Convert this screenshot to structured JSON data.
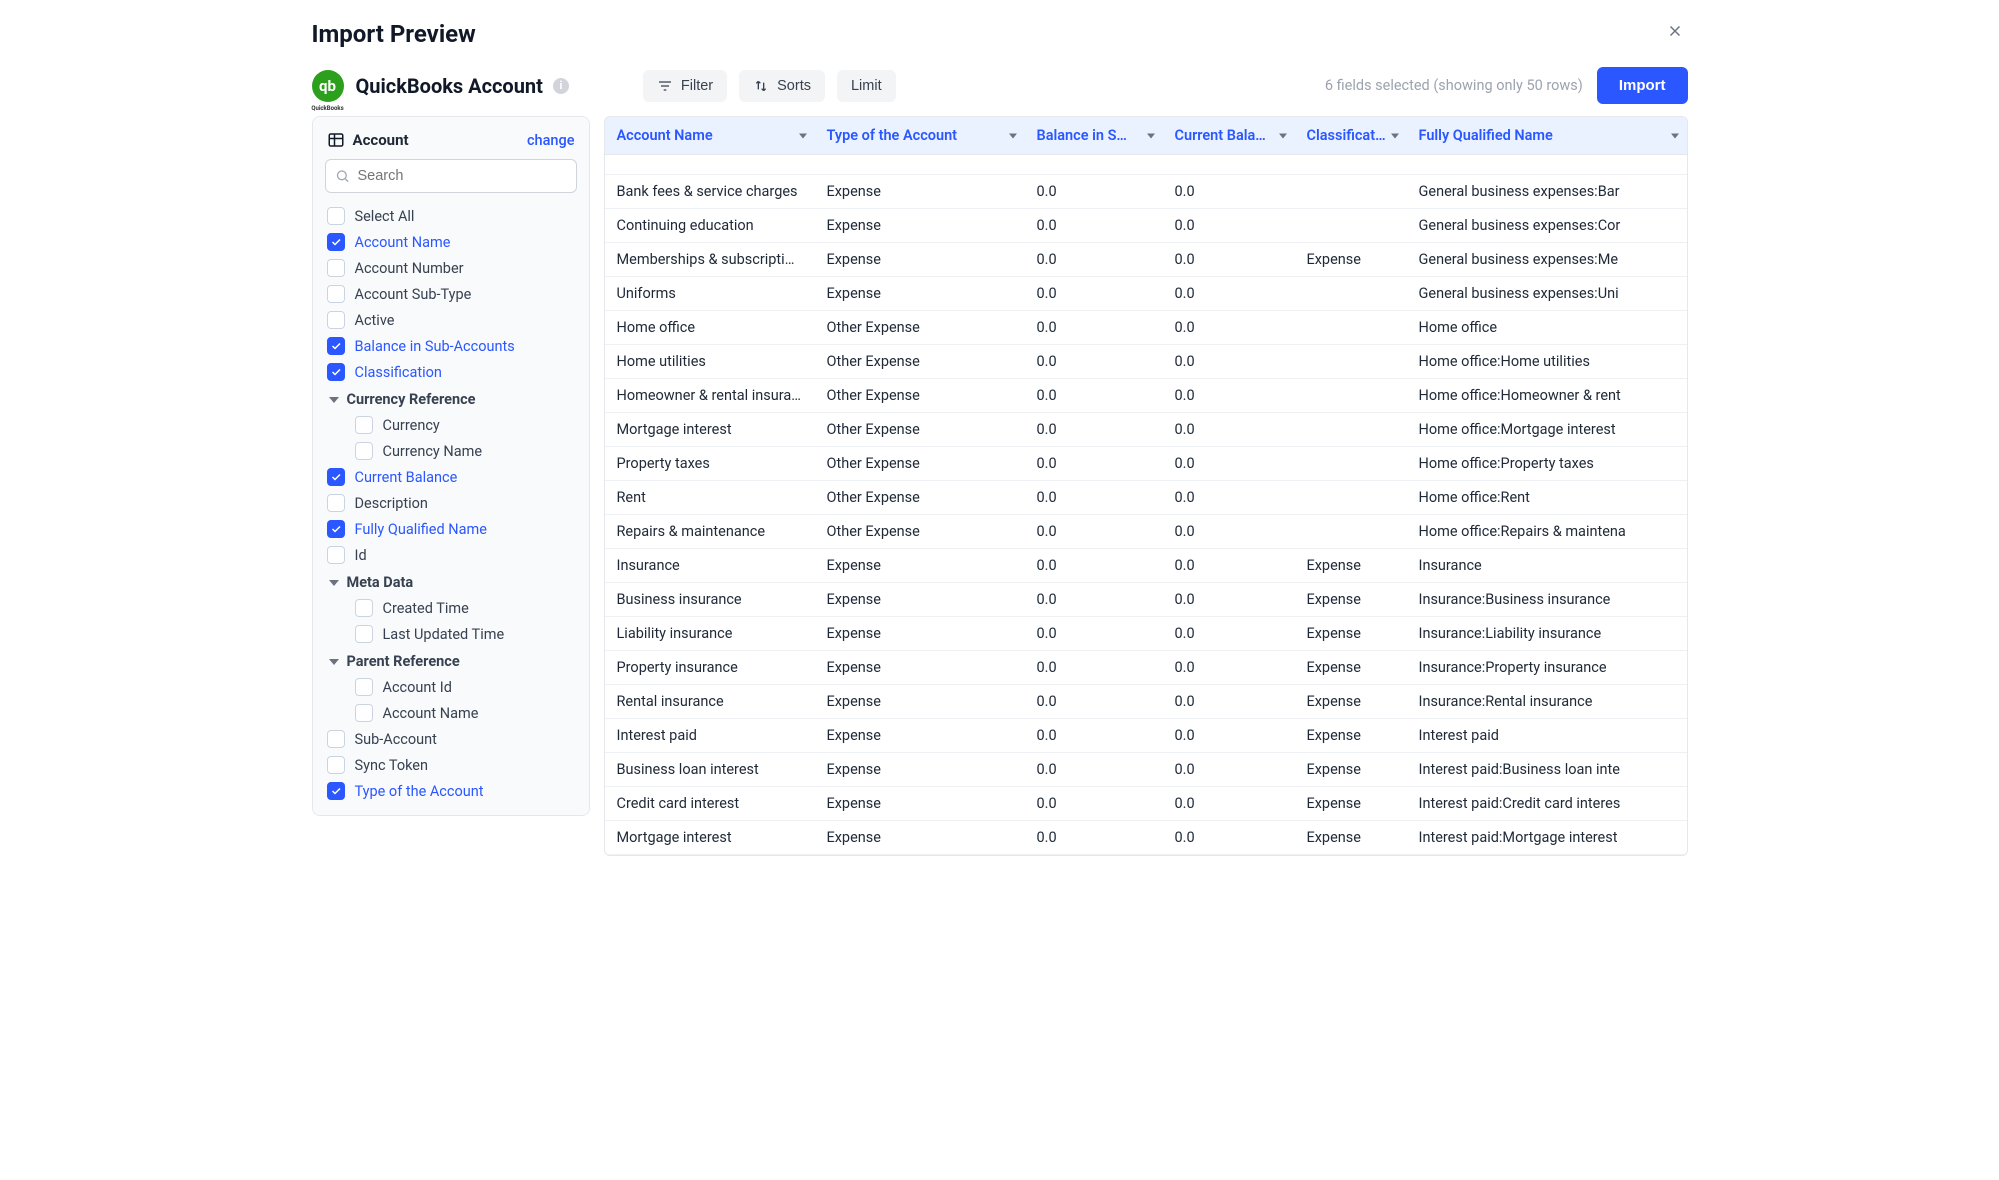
{
  "header": {
    "title": "Import Preview"
  },
  "source": {
    "title": "QuickBooks Account"
  },
  "toolbar": {
    "filter_label": "Filter",
    "sorts_label": "Sorts",
    "limit_label": "Limit",
    "selected_note": "6 fields selected (showing only 50 rows)",
    "import_label": "Import"
  },
  "sidebar": {
    "header_label": "Account",
    "change_label": "change",
    "search_placeholder": "Search",
    "fields": [
      {
        "label": "Select All",
        "checked": false
      },
      {
        "label": "Account Name",
        "checked": true
      },
      {
        "label": "Account Number",
        "checked": false
      },
      {
        "label": "Account Sub-Type",
        "checked": false
      },
      {
        "label": "Active",
        "checked": false
      },
      {
        "label": "Balance in Sub-Accounts",
        "checked": true
      },
      {
        "label": "Classification",
        "checked": true
      }
    ],
    "group_currency": {
      "title": "Currency Reference",
      "items": [
        {
          "label": "Currency",
          "checked": false
        },
        {
          "label": "Currency Name",
          "checked": false
        }
      ]
    },
    "fields2": [
      {
        "label": "Current Balance",
        "checked": true
      },
      {
        "label": "Description",
        "checked": false
      },
      {
        "label": "Fully Qualified Name",
        "checked": true
      },
      {
        "label": "Id",
        "checked": false
      }
    ],
    "group_meta": {
      "title": "Meta Data",
      "items": [
        {
          "label": "Created Time",
          "checked": false
        },
        {
          "label": "Last Updated Time",
          "checked": false
        }
      ]
    },
    "group_parent": {
      "title": "Parent Reference",
      "items": [
        {
          "label": "Account Id",
          "checked": false
        },
        {
          "label": "Account Name",
          "checked": false
        }
      ]
    },
    "fields3": [
      {
        "label": "Sub-Account",
        "checked": false
      },
      {
        "label": "Sync Token",
        "checked": false
      },
      {
        "label": "Type of the Account",
        "checked": true
      }
    ]
  },
  "table": {
    "columns": [
      {
        "label": "Account Name"
      },
      {
        "label": "Type of the Account"
      },
      {
        "label": "Balance in S…"
      },
      {
        "label": "Current Bala…"
      },
      {
        "label": "Classificat…"
      },
      {
        "label": "Fully Qualified Name"
      }
    ],
    "rows": [
      {
        "name": "Bank fees & service charges",
        "type": "Expense",
        "bal": "0.0",
        "cur": "0.0",
        "class": "",
        "fqn": "General business expenses:Bar"
      },
      {
        "name": "Continuing education",
        "type": "Expense",
        "bal": "0.0",
        "cur": "0.0",
        "class": "",
        "fqn": "General business expenses:Cor"
      },
      {
        "name": "Memberships & subscriptions",
        "type": "Expense",
        "bal": "0.0",
        "cur": "0.0",
        "class": "Expense",
        "fqn": "General business expenses:Me"
      },
      {
        "name": "Uniforms",
        "type": "Expense",
        "bal": "0.0",
        "cur": "0.0",
        "class": "",
        "fqn": "General business expenses:Uni"
      },
      {
        "name": "Home office",
        "type": "Other Expense",
        "bal": "0.0",
        "cur": "0.0",
        "class": "",
        "fqn": "Home office"
      },
      {
        "name": "Home utilities",
        "type": "Other Expense",
        "bal": "0.0",
        "cur": "0.0",
        "class": "",
        "fqn": "Home office:Home utilities"
      },
      {
        "name": "Homeowner & rental insurance",
        "type": "Other Expense",
        "bal": "0.0",
        "cur": "0.0",
        "class": "",
        "fqn": "Home office:Homeowner & rent"
      },
      {
        "name": "Mortgage interest",
        "type": "Other Expense",
        "bal": "0.0",
        "cur": "0.0",
        "class": "",
        "fqn": "Home office:Mortgage interest"
      },
      {
        "name": "Property taxes",
        "type": "Other Expense",
        "bal": "0.0",
        "cur": "0.0",
        "class": "",
        "fqn": "Home office:Property taxes"
      },
      {
        "name": "Rent",
        "type": "Other Expense",
        "bal": "0.0",
        "cur": "0.0",
        "class": "",
        "fqn": "Home office:Rent"
      },
      {
        "name": "Repairs & maintenance",
        "type": "Other Expense",
        "bal": "0.0",
        "cur": "0.0",
        "class": "",
        "fqn": "Home office:Repairs & maintena"
      },
      {
        "name": "Insurance",
        "type": "Expense",
        "bal": "0.0",
        "cur": "0.0",
        "class": "Expense",
        "fqn": "Insurance"
      },
      {
        "name": "Business insurance",
        "type": "Expense",
        "bal": "0.0",
        "cur": "0.0",
        "class": "Expense",
        "fqn": "Insurance:Business insurance"
      },
      {
        "name": "Liability insurance",
        "type": "Expense",
        "bal": "0.0",
        "cur": "0.0",
        "class": "Expense",
        "fqn": "Insurance:Liability insurance"
      },
      {
        "name": "Property insurance",
        "type": "Expense",
        "bal": "0.0",
        "cur": "0.0",
        "class": "Expense",
        "fqn": "Insurance:Property insurance"
      },
      {
        "name": "Rental insurance",
        "type": "Expense",
        "bal": "0.0",
        "cur": "0.0",
        "class": "Expense",
        "fqn": "Insurance:Rental insurance"
      },
      {
        "name": "Interest paid",
        "type": "Expense",
        "bal": "0.0",
        "cur": "0.0",
        "class": "Expense",
        "fqn": "Interest paid"
      },
      {
        "name": "Business loan interest",
        "type": "Expense",
        "bal": "0.0",
        "cur": "0.0",
        "class": "Expense",
        "fqn": "Interest paid:Business loan inte"
      },
      {
        "name": "Credit card interest",
        "type": "Expense",
        "bal": "0.0",
        "cur": "0.0",
        "class": "Expense",
        "fqn": "Interest paid:Credit card interes"
      },
      {
        "name": "Mortgage interest",
        "type": "Expense",
        "bal": "0.0",
        "cur": "0.0",
        "class": "Expense",
        "fqn": "Interest paid:Mortgage interest"
      }
    ]
  }
}
